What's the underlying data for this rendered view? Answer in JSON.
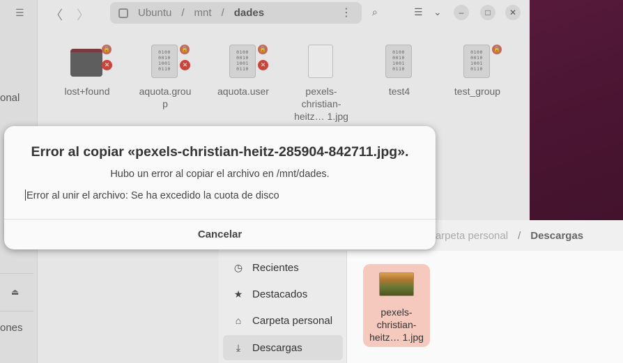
{
  "back_window": {
    "sidebar": {
      "menu_icon": "hamburger-icon",
      "partial_label_1": "onal",
      "partial_label_2": "ones",
      "eject_icon": "eject-icon"
    },
    "nav": {
      "back_icon": "chevron-left-icon",
      "forward_icon": "chevron-right-icon"
    },
    "path": {
      "icon": "disk-icon",
      "segments": [
        "Ubuntu",
        "/",
        "mnt",
        "/",
        "dades"
      ],
      "menu_icon": "kebab-menu-icon"
    },
    "header_icons": [
      "search-folder-icon",
      "list-view-icon",
      "chevron-down-icon"
    ],
    "window_controls": {
      "minimize": "minimize-icon",
      "maximize": "maximize-icon",
      "close": "close-icon"
    },
    "files": [
      {
        "name": "lost+found",
        "type": "folder"
      },
      {
        "name": "aquota.grou\np",
        "type": "binary"
      },
      {
        "name": "aquota.user",
        "type": "binary"
      },
      {
        "name": "pexels-\nchristian-\nheitz… 1.jpg",
        "type": "image"
      },
      {
        "name": "test4",
        "type": "binary"
      },
      {
        "name": "test_group",
        "type": "binary"
      }
    ],
    "binary_glyph": "0100\n0010\n1001\n0110"
  },
  "downloads_window": {
    "path": {
      "home": "Carpeta personal",
      "sep": "/",
      "current": "Descargas"
    },
    "sidebar": [
      {
        "label": "Recientes",
        "icon": "clock-icon"
      },
      {
        "label": "Destacados",
        "icon": "star-icon"
      },
      {
        "label": "Carpeta personal",
        "icon": "home-icon"
      },
      {
        "label": "Descargas",
        "icon": "download-icon",
        "active": true
      }
    ],
    "file": {
      "name": "pexels-\nchristian-\nheitz… 1.jpg"
    }
  },
  "dialog": {
    "title": "Error al copiar «pexels-christian-heitz-285904-842711.jpg».",
    "message": "Hubo un error al copiar el archivo en /mnt/dades.",
    "detail": "Error al unir el archivo: Se ha excedido la cuota de disco",
    "cancel_label": "Cancelar"
  },
  "colors": {
    "wallpaper": "#5b1a3c",
    "dialog_bg": "#fafafa",
    "selected_file_bg": "#f5c9bd",
    "error_badge": "#c9453a"
  }
}
